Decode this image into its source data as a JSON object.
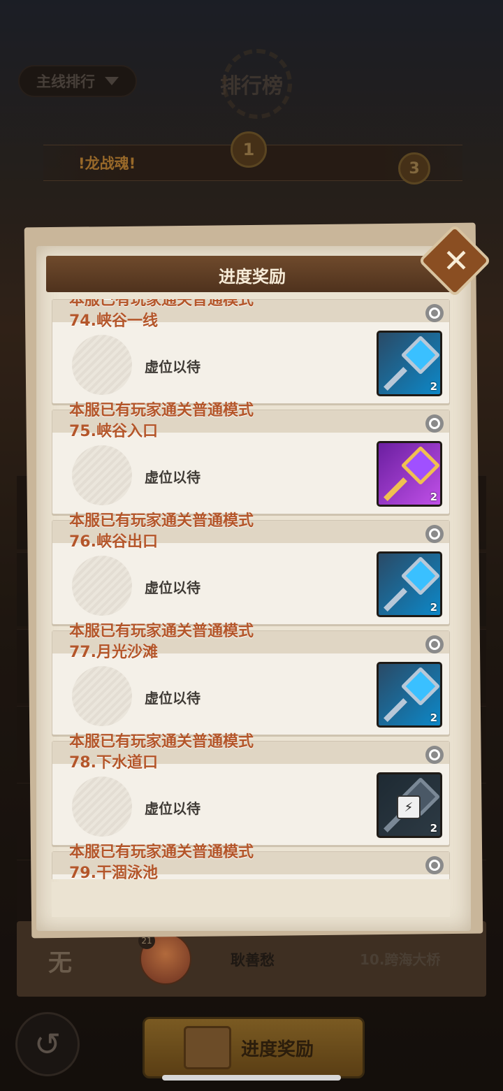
{
  "header": {
    "rank_dropdown": "主线排行",
    "title": "排行榜",
    "banner_text": "!龙战魂!"
  },
  "modal": {
    "title": "进度奖励",
    "items": [
      {
        "title": "本服已有玩家通关普通模式",
        "stage": "74.峡谷一线",
        "slot": "虚位以待",
        "reward": "blue",
        "count": "2"
      },
      {
        "title": "本服已有玩家通关普通模式",
        "stage": "75.峡谷入口",
        "slot": "虚位以待",
        "reward": "purple",
        "count": "2"
      },
      {
        "title": "本服已有玩家通关普通模式",
        "stage": "76.峡谷出口",
        "slot": "虚位以待",
        "reward": "blue",
        "count": "2"
      },
      {
        "title": "本服已有玩家通关普通模式",
        "stage": "77.月光沙滩",
        "slot": "虚位以待",
        "reward": "blue",
        "count": "2"
      },
      {
        "title": "本服已有玩家通关普通模式",
        "stage": "78.下水道口",
        "slot": "虚位以待",
        "reward": "dark",
        "count": "2"
      },
      {
        "title": "本服已有玩家通关普通模式",
        "stage": "79.干涸泳池",
        "slot": "",
        "reward": "",
        "count": ""
      }
    ]
  },
  "bottom": {
    "rank": "无",
    "level": "21",
    "player_name": "耿善愁",
    "stage": "10.跨海大桥",
    "progress_button": "进度奖励"
  }
}
